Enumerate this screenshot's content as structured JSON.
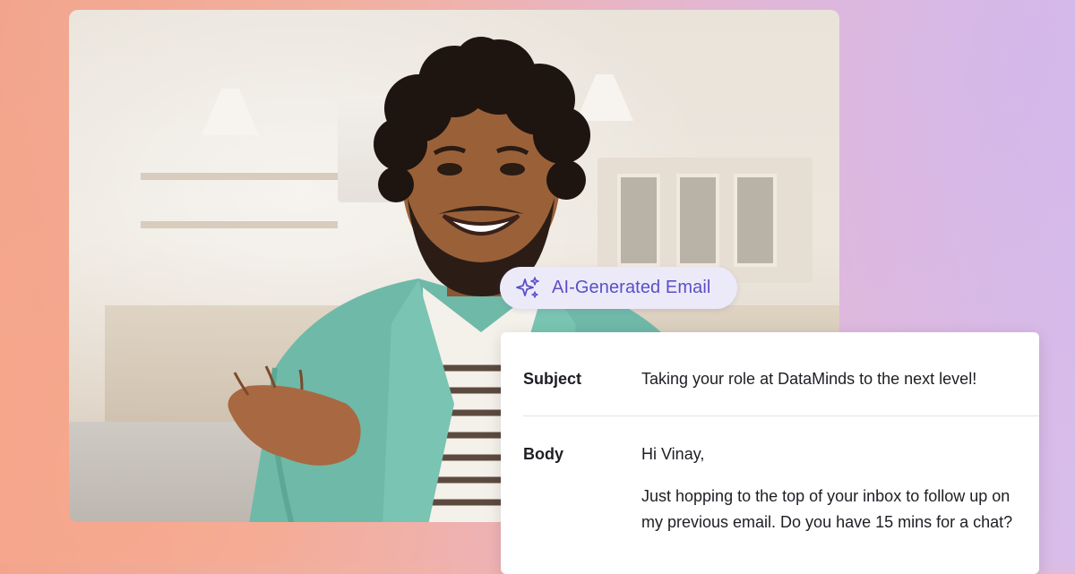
{
  "badge": {
    "label": "AI-Generated Email",
    "icon": "sparkles-icon",
    "accent": "#5b4fc5"
  },
  "email": {
    "subject_label": "Subject",
    "subject_value": "Taking your role at DataMinds to the next level!",
    "body_label": "Body",
    "body_greeting": "Hi Vinay,",
    "body_paragraph": "Just hopping to the top of your inbox to follow up on my previous email. Do you have 15 mins for a chat?"
  }
}
